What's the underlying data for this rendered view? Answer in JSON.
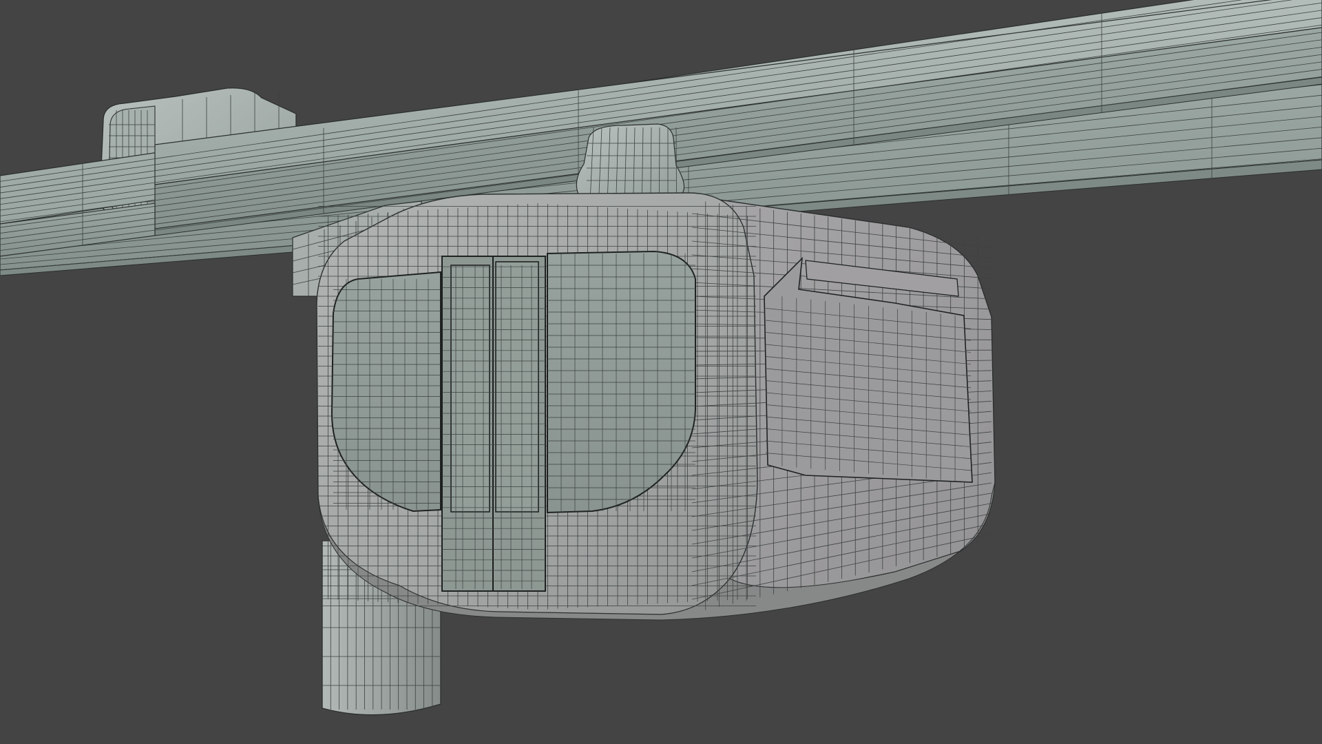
{
  "scene": {
    "subject": "suspended-monorail-cabin-wireframe",
    "render_mode": "shaded-wireframe",
    "objects": [
      "front-rail-beam",
      "rear-rail-beam",
      "hanger-bracket",
      "top-connector",
      "support-pillar",
      "cabin-body",
      "cabin-front-window",
      "cabin-side-window",
      "cabin-door"
    ]
  },
  "colors": {
    "background": "#444444",
    "rail_top": "#a9b4b0",
    "rail_face": "#93a09b",
    "rail_underside": "#7e8a86",
    "cabin_front": "#a4a7a6",
    "cabin_side": "#9d9c9e",
    "cabin_shade": "#8d8f8e",
    "window": "#8d9894",
    "door": "#8e9893",
    "pillar": "#9aa29f",
    "wire": "#2b2f2e",
    "wire_light": "#5a605e"
  }
}
